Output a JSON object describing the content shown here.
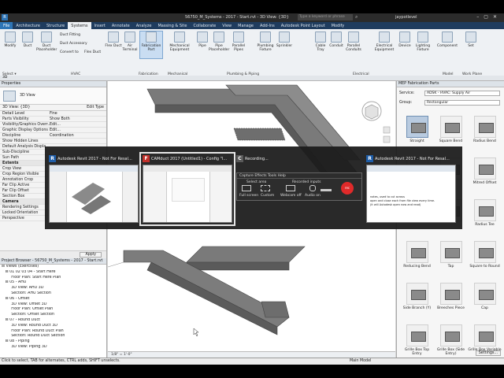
{
  "window": {
    "title": "56750_M_Systems - 2017 - Start.rvt - 3D View: {3D}",
    "search_placeholder": "Type a keyword or phrase",
    "user": "jaypotlevel"
  },
  "ribbon_tabs": [
    "File",
    "Architecture",
    "Structure",
    "Systems",
    "Insert",
    "Annotate",
    "Analyze",
    "Massing & Site",
    "Collaborate",
    "View",
    "Manage",
    "Add-Ins",
    "Autodesk Point Layout",
    "Modify"
  ],
  "ribbon": {
    "buttons": [
      {
        "label": "Modify"
      },
      {
        "label": "Duct"
      },
      {
        "label": "Duct Placeholder"
      },
      {
        "label": "Flex Duct"
      },
      {
        "label": "Air Terminal"
      },
      {
        "label": "Fabrication Part"
      },
      {
        "label": "Mechanical Equipment"
      },
      {
        "label": "Pipe"
      },
      {
        "label": "Pipe Placeholder"
      },
      {
        "label": "Parallel Pipes"
      },
      {
        "label": "Plumbing Fixture"
      },
      {
        "label": "Sprinkler"
      },
      {
        "label": "Cable Tray"
      },
      {
        "label": "Conduit"
      },
      {
        "label": "Parallel Conduits"
      },
      {
        "label": "Electrical Equipment"
      },
      {
        "label": "Device"
      },
      {
        "label": "Lighting Fixture"
      },
      {
        "label": "Component"
      },
      {
        "label": "Set"
      }
    ],
    "small_items": [
      "Duct Fitting",
      "Duct Accessory",
      "Convert to",
      "Flex Duct"
    ],
    "panels": [
      "Select",
      "HVAC",
      "Fabrication",
      "Mechanical",
      "Plumbing & Piping",
      "Electrical",
      "Model",
      "Work Plane"
    ],
    "select_label": "Select ▾"
  },
  "properties": {
    "header": "Properties",
    "type_name": "3D View",
    "view_selector": "3D View: {3D}",
    "edit_type": "Edit Type",
    "rows": [
      {
        "k": "Detail Level",
        "v": "Fine",
        "cat": false
      },
      {
        "k": "Parts Visibility",
        "v": "Show Both",
        "cat": false
      },
      {
        "k": "Visibility/Graphics Overr...",
        "v": "Edit...",
        "cat": false
      },
      {
        "k": "Graphic Display Options",
        "v": "Edit...",
        "cat": false
      },
      {
        "k": "Discipline",
        "v": "Coordination",
        "cat": false
      },
      {
        "k": "Show Hidden Lines",
        "v": "",
        "cat": false
      },
      {
        "k": "Default Analysis Displa...",
        "v": "",
        "cat": false
      },
      {
        "k": "Sub-Discipline",
        "v": "",
        "cat": false
      },
      {
        "k": "Sun Path",
        "v": "",
        "cat": false
      },
      {
        "k": "Extents",
        "v": "",
        "cat": true
      },
      {
        "k": "Crop View",
        "v": "",
        "cat": false
      },
      {
        "k": "Crop Region Visible",
        "v": "",
        "cat": false
      },
      {
        "k": "Annotation Crop",
        "v": "",
        "cat": false
      },
      {
        "k": "Far Clip Active",
        "v": "",
        "cat": false
      },
      {
        "k": "Far Clip Offset",
        "v": "",
        "cat": false
      },
      {
        "k": "Section Box",
        "v": "",
        "cat": false
      },
      {
        "k": "Camera",
        "v": "",
        "cat": true
      },
      {
        "k": "Rendering Settings",
        "v": "",
        "cat": false
      },
      {
        "k": "Locked Orientation",
        "v": "",
        "cat": false
      },
      {
        "k": "Perspective",
        "v": "",
        "cat": false
      }
    ],
    "apply": "Apply"
  },
  "browser": {
    "header": "Project Browser - 56750_M_Systems - 2017 - Start.rvt",
    "items": [
      "⊟ Views (Exercises)",
      "   ⊟ 01 02 03 04 - Start Here",
      "        Floor Plan: Start Here Plan",
      "   ⊟ 05 - AHU",
      "        3D View: AHU 3D",
      "        Section: AHU Section",
      "   ⊟ 06 - Offset",
      "        3D View: Offset 3D",
      "        Floor Plan: Offset Plan",
      "        Section: Offset Section",
      "   ⊟ 07 - Round Duct",
      "        3D View: Round Duct 3D",
      "        Floor Plan: Round Duct Plan",
      "        Section: Round Duct Section",
      "   ⊟ 08 - Piping",
      "        3D View: Piping 3D"
    ]
  },
  "viewport": {
    "scale": "1/8\" = 1'-0\"",
    "viewcube": "FRONT"
  },
  "fab_panel": {
    "header": "MEP Fabrication Parts",
    "service_label": "Service:",
    "service_value": "ADSK - HVAC: Supply Air",
    "group_label": "Group:",
    "group_value": "Rectangular",
    "parts": [
      "Straight",
      "Square Bend",
      "Radius Bend",
      "",
      "",
      "Mitred Offset",
      "",
      "",
      "Radius Tee",
      "Reducing Bend",
      "Tap",
      "Square to Round",
      "Side Branch (Y)",
      "Breeches Piece",
      "Cap",
      "Grille Box Top Entry",
      "Grille Box (Side Entry)",
      "Grille Box Variable Hole"
    ],
    "settings": "Settings..."
  },
  "statusbar": {
    "hint": "Click to select, TAB for alternates, CTRL adds, SHIFT unselects.",
    "model": "Main Model"
  },
  "switcher": {
    "windows": [
      {
        "badge": "R",
        "title": "Autodesk Revit 2017 - Not For Resal...",
        "color": "#1e5da8"
      },
      {
        "badge": "F",
        "title": "CAMduct 2017 (Untitled1) - Config \"I...",
        "color": "#c2302a"
      },
      {
        "badge": "C",
        "title": "Recording...",
        "color": "#5a5a5a"
      },
      {
        "badge": "R",
        "title": "Autodesk Revit 2017 - Not For Resal...",
        "color": "#1e5da8"
      }
    ],
    "recorder": {
      "menu": "Capture   Effects   Tools   Help",
      "select_area": "Select area",
      "recorded_inputs": "Recorded inputs",
      "full_screen": "Full screen",
      "custom": "Custom",
      "webcam": "Webcam off",
      "audio": "Audio on",
      "rec": "rec"
    },
    "notes": [
      "notes, used to cut across",
      "open and close each from file view every time.",
      "(it will Autodesk open now and read)"
    ]
  }
}
